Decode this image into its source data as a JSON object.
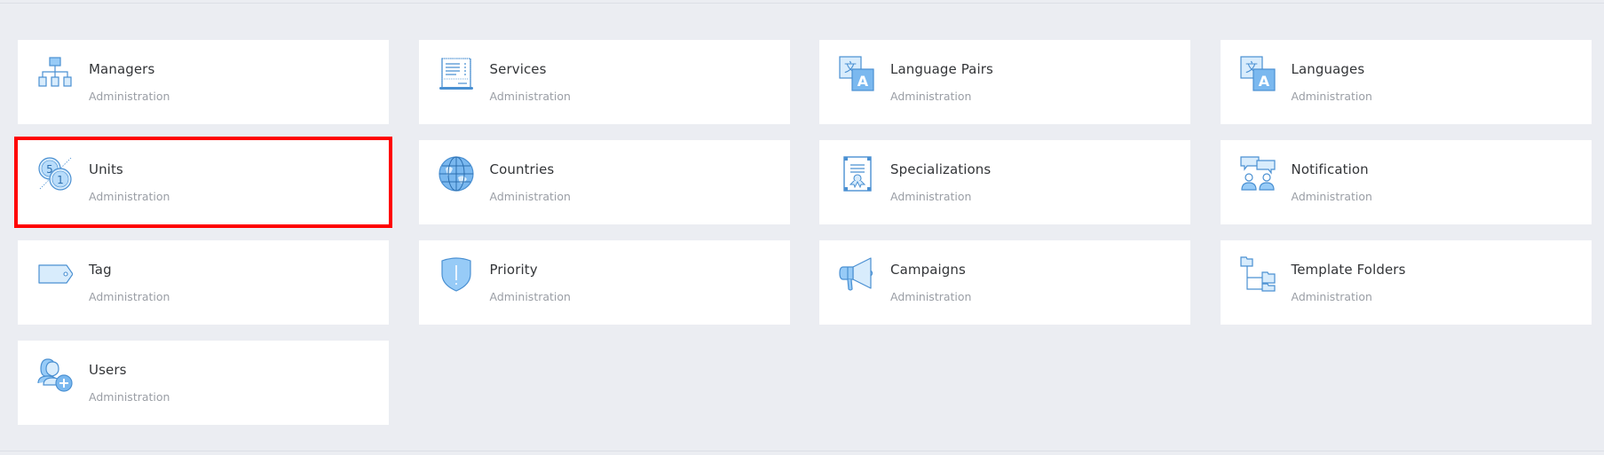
{
  "colors": {
    "background": "#ebedf2",
    "card": "#ffffff",
    "icon_stroke": "#4a90d2",
    "icon_fill": "#97cbf7",
    "icon_fill_light": "#d8ecfc",
    "selection": "#ff0000",
    "title": "#333538",
    "subtitle": "#9a9ea5"
  },
  "tiles": [
    {
      "title": "Managers",
      "subtitle": "Administration",
      "icon": "org-chart-icon",
      "selected": false
    },
    {
      "title": "Services",
      "subtitle": "Administration",
      "icon": "receipt-icon",
      "selected": false
    },
    {
      "title": "Language Pairs",
      "subtitle": "Administration",
      "icon": "translate-icon",
      "selected": false
    },
    {
      "title": "Languages",
      "subtitle": "Administration",
      "icon": "translate-icon",
      "selected": false
    },
    {
      "title": "Units",
      "subtitle": "Administration",
      "icon": "units-coins-icon",
      "selected": true
    },
    {
      "title": "Countries",
      "subtitle": "Administration",
      "icon": "globe-icon",
      "selected": false
    },
    {
      "title": "Specializations",
      "subtitle": "Administration",
      "icon": "certificate-icon",
      "selected": false
    },
    {
      "title": "Notification",
      "subtitle": "Administration",
      "icon": "chat-users-icon",
      "selected": false
    },
    {
      "title": "Tag",
      "subtitle": "Administration",
      "icon": "tag-icon",
      "selected": false
    },
    {
      "title": "Priority",
      "subtitle": "Administration",
      "icon": "shield-alert-icon",
      "selected": false
    },
    {
      "title": "Campaigns",
      "subtitle": "Administration",
      "icon": "megaphone-icon",
      "selected": false
    },
    {
      "title": "Template Folders",
      "subtitle": "Administration",
      "icon": "folder-tree-icon",
      "selected": false
    },
    {
      "title": "Users",
      "subtitle": "Administration",
      "icon": "add-users-icon",
      "selected": false
    }
  ]
}
